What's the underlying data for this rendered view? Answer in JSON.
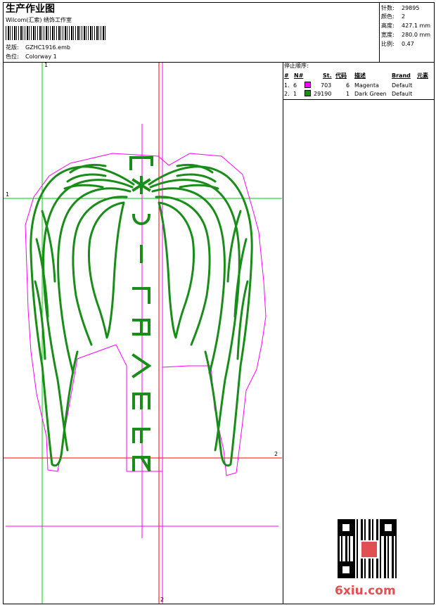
{
  "header": {
    "title": "生产作业图",
    "company": "Wilcom(汇索) 绣饰工作室",
    "design_label": "花版:",
    "design_value": "GZHC1916.emb",
    "colorway_label": "色位:",
    "colorway_value": "Colorway 1"
  },
  "specs": [
    {
      "label": "针数:",
      "value": "29895"
    },
    {
      "label": "颜色:",
      "value": "2"
    },
    {
      "label": "高度:",
      "value": "427.1 mm"
    },
    {
      "label": "宽度:",
      "value": "280.0 mm"
    },
    {
      "label": "比例:",
      "value": "0.47"
    }
  ],
  "stop_sequence": {
    "title": "停止顺序:",
    "columns": {
      "num": "#",
      "needle": "N#",
      "stitches": "St.",
      "code": "代码",
      "desc": "描述",
      "brand": "Brand",
      "element": "元素"
    },
    "rows": [
      {
        "num": "1.",
        "needle": "6",
        "color": "#ff00ff",
        "stitches": "703",
        "code": "6",
        "desc": "Magenta",
        "brand": "Default"
      },
      {
        "num": "2.",
        "needle": "1",
        "color": "#1a8c1a",
        "stitches": "29190",
        "code": "1",
        "desc": "Dark Green",
        "brand": "Default"
      }
    ]
  },
  "guides": {
    "top_1": "1",
    "left_1": "1",
    "right_2": "2",
    "bottom_2": "2"
  },
  "embroidery_text": "REEVES-(J)",
  "colors": {
    "magenta": "#ff00ff",
    "green": "#1a8c1a",
    "guide_green": "#00cc00",
    "guide_red": "#ff0000"
  },
  "watermark": "6xiu.com"
}
